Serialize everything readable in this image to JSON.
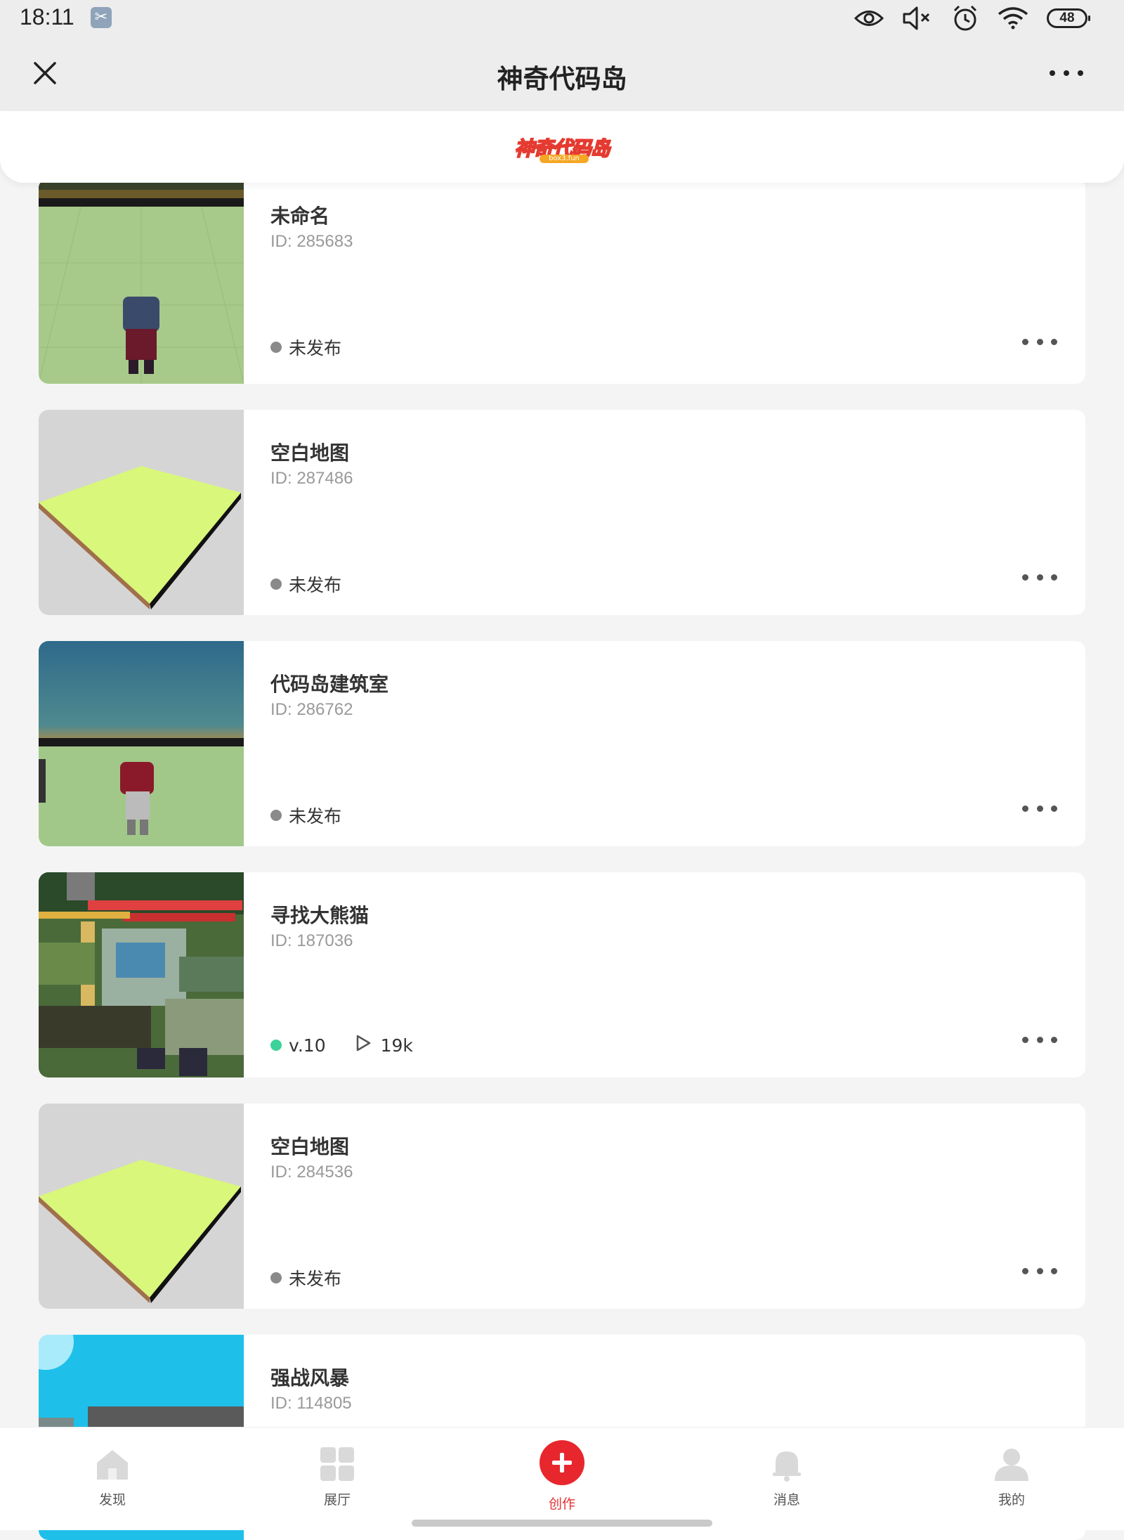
{
  "status_bar": {
    "time": "18:11",
    "battery": "48",
    "icons": [
      "scissors-icon",
      "eye-icon",
      "mute-icon",
      "alarm-icon",
      "wifi-icon",
      "battery-icon"
    ]
  },
  "header": {
    "title": "神奇代码岛",
    "close_icon": "close-icon",
    "more_icon": "more-icon"
  },
  "logo": {
    "text": "神奇代码岛",
    "subtext": "box3.fun"
  },
  "projects": [
    {
      "title": "未命名",
      "id_text": "ID: 285683",
      "status": "未发布",
      "published": false,
      "thumbnail": "character-on-grass"
    },
    {
      "title": "空白地图",
      "id_text": "ID: 287486",
      "status": "未发布",
      "published": false,
      "thumbnail": "empty-plane"
    },
    {
      "title": "代码岛建筑室",
      "id_text": "ID: 286762",
      "status": "未发布",
      "published": false,
      "thumbnail": "character-on-grass-2"
    },
    {
      "title": "寻找大熊猫",
      "id_text": "ID: 187036",
      "status": "v.10",
      "published": true,
      "plays": "19k",
      "thumbnail": "town-scene"
    },
    {
      "title": "空白地图",
      "id_text": "ID: 284536",
      "status": "未发布",
      "published": false,
      "thumbnail": "empty-plane"
    },
    {
      "title": "强战风暴",
      "id_text": "ID: 114805",
      "status": "",
      "published": false,
      "thumbnail": "sky-scene"
    }
  ],
  "nav": [
    {
      "label": "发现",
      "icon": "home-icon",
      "active": false
    },
    {
      "label": "展厅",
      "icon": "grid-icon",
      "active": false
    },
    {
      "label": "创作",
      "icon": "plus-icon",
      "active": true
    },
    {
      "label": "消息",
      "icon": "bell-icon",
      "active": false
    },
    {
      "label": "我的",
      "icon": "user-icon",
      "active": false
    }
  ],
  "colors": {
    "accent": "#e8262d",
    "published_dot": "#3cd29a",
    "unpublished_dot": "#8a8a8a"
  }
}
